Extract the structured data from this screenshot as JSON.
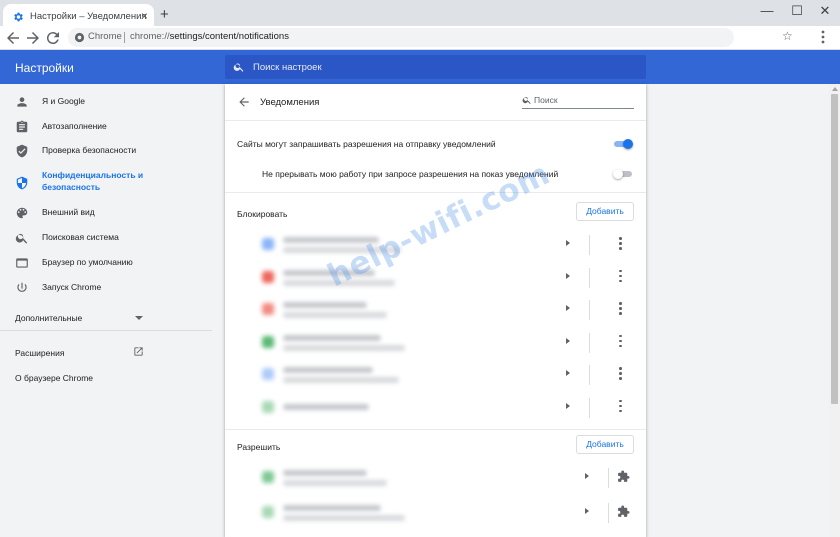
{
  "browser": {
    "tab_title": "Настройки – Уведомления",
    "tab_close": "×",
    "new_tab": "+",
    "window_min": "—",
    "window_max": "☐",
    "window_close": "✕",
    "omnibox_label": "Chrome",
    "omnibox_url_scheme": "chrome://",
    "omnibox_url_path": "settings/content/notifications",
    "star": "☆"
  },
  "header": {
    "title": "Настройки",
    "search_placeholder": "Поиск настроек",
    "brand_color": "#3367d6"
  },
  "sidebar": {
    "items": [
      {
        "label": "Я и Google",
        "icon": "person-icon"
      },
      {
        "label": "Автозаполнение",
        "icon": "clipboard-icon"
      },
      {
        "label": "Проверка безопасности",
        "icon": "shield-icon"
      },
      {
        "label": "Конфиденциальность и безопасность",
        "icon": "security-shield-icon",
        "active": true
      },
      {
        "label": "Внешний вид",
        "icon": "palette-icon"
      },
      {
        "label": "Поисковая система",
        "icon": "search-icon"
      },
      {
        "label": "Браузер по умолчанию",
        "icon": "browser-icon"
      },
      {
        "label": "Запуск Chrome",
        "icon": "power-icon"
      }
    ],
    "advanced": "Дополнительные",
    "extensions": "Расширения",
    "about": "О браузере Chrome"
  },
  "main": {
    "title": "Уведомления",
    "search_placeholder": "Поиск",
    "ask_setting": {
      "label": "Сайты могут запрашивать разрешения на отправку уведомлений",
      "enabled": true
    },
    "quiet_setting": {
      "label": "Не прерывать мою работу при запросе разрешения на показ уведомлений",
      "enabled": false
    },
    "blocked": {
      "label": "Блокировать",
      "add_label": "Добавить",
      "sites": [
        {
          "favicon_color": "#8ab4f8"
        },
        {
          "favicon_color": "#ee675c"
        },
        {
          "favicon_color": "#f28b82"
        },
        {
          "favicon_color": "#5bb974"
        },
        {
          "favicon_color": "#aecbfa"
        },
        {
          "favicon_color": "#a8dab5"
        }
      ]
    },
    "allowed": {
      "label": "Разрешить",
      "add_label": "Добавить",
      "sites": [
        {
          "favicon_color": "#81c995"
        },
        {
          "favicon_color": "#a8dab5"
        }
      ]
    }
  },
  "watermark": "help-wifi.com"
}
